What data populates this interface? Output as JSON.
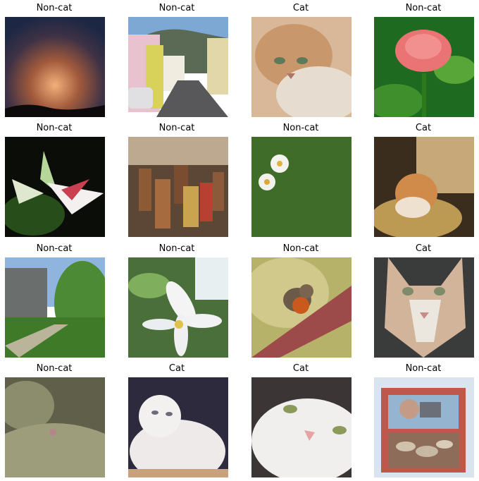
{
  "grid": {
    "items": [
      {
        "label": "Non-cat",
        "subject": "sunset-clouds"
      },
      {
        "label": "Non-cat",
        "subject": "street"
      },
      {
        "label": "Cat",
        "subject": "tabby-cat-closeup"
      },
      {
        "label": "Non-cat",
        "subject": "red-rose"
      },
      {
        "label": "Non-cat",
        "subject": "white-lily"
      },
      {
        "label": "Non-cat",
        "subject": "drums"
      },
      {
        "label": "Non-cat",
        "subject": "daisies-on-grass"
      },
      {
        "label": "Cat",
        "subject": "cat-on-cushion"
      },
      {
        "label": "Non-cat",
        "subject": "garden-path"
      },
      {
        "label": "Non-cat",
        "subject": "white-flower"
      },
      {
        "label": "Non-cat",
        "subject": "robin-bird"
      },
      {
        "label": "Cat",
        "subject": "cat-face"
      },
      {
        "label": "Non-cat",
        "subject": "moth-leaf"
      },
      {
        "label": "Cat",
        "subject": "white-fluffy-cat"
      },
      {
        "label": "Cat",
        "subject": "white-cat-closeup"
      },
      {
        "label": "Non-cat",
        "subject": "photo-box"
      }
    ]
  }
}
